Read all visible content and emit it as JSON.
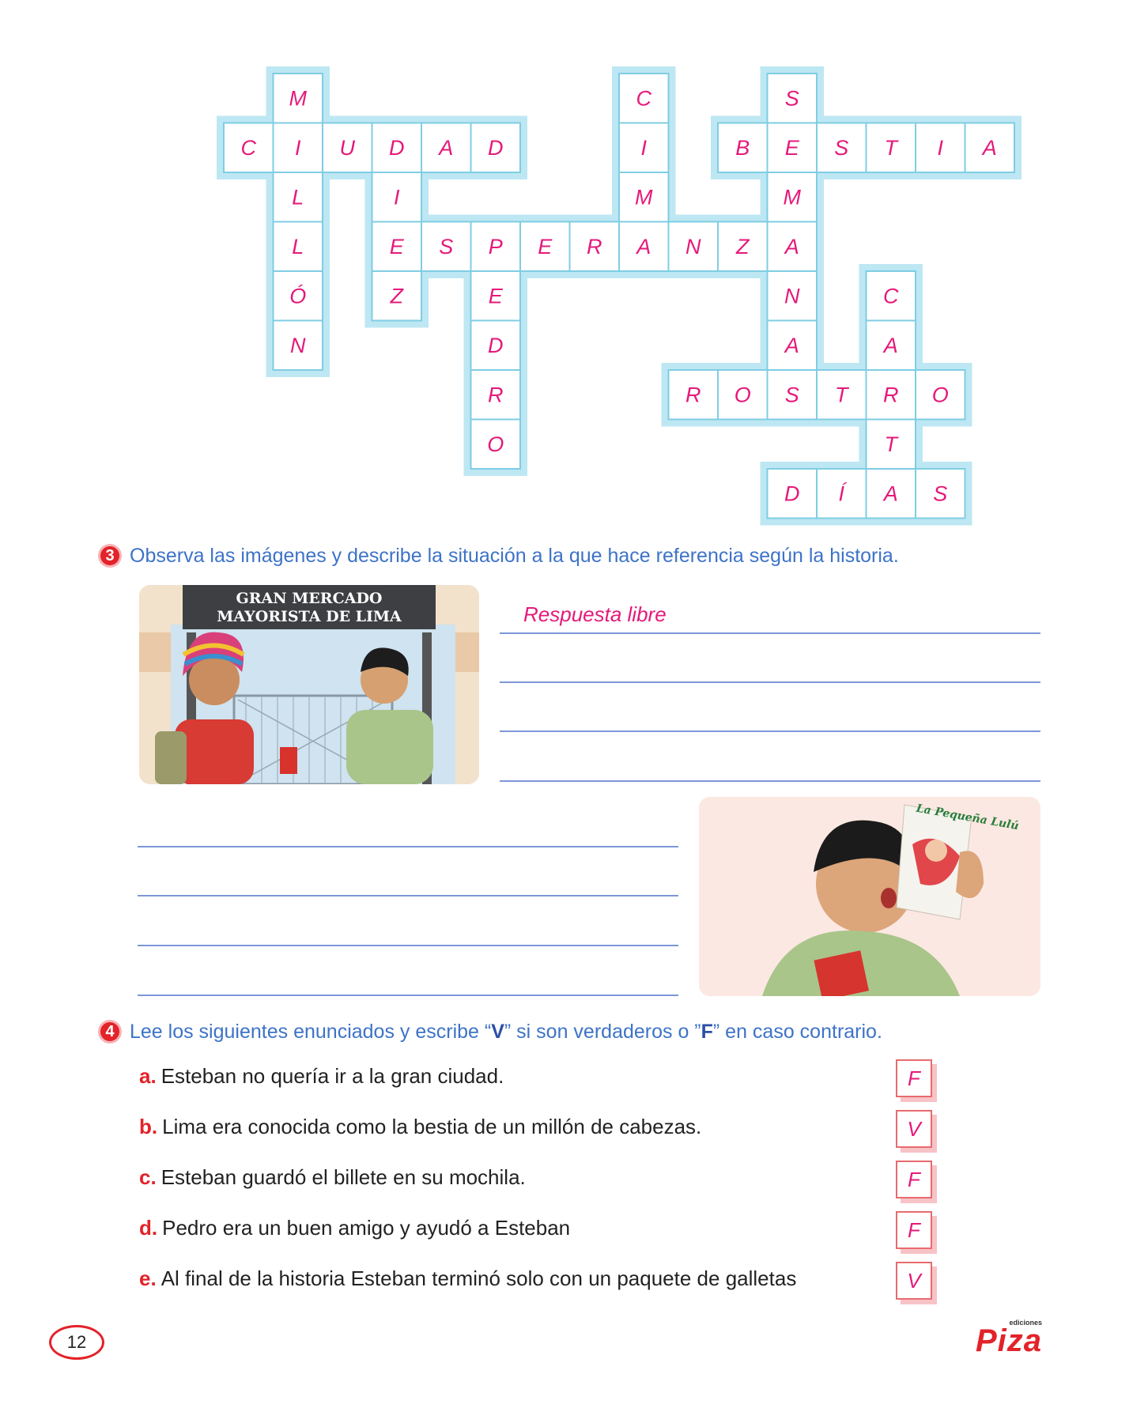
{
  "crossword": {
    "words": [
      {
        "id": "millon",
        "row": 0,
        "col": 1,
        "dir": "down",
        "letters": [
          "M",
          "I",
          "L",
          "L",
          "Ó",
          "N"
        ]
      },
      {
        "id": "ciudad",
        "row": 1,
        "col": 0,
        "dir": "across",
        "letters": [
          "C",
          "I",
          "U",
          "D",
          "A",
          "D"
        ]
      },
      {
        "id": "diez",
        "row": 1,
        "col": 3,
        "dir": "down",
        "letters": [
          "D",
          "I",
          "E",
          "Z"
        ]
      },
      {
        "id": "cima",
        "row": 0,
        "col": 8,
        "dir": "down",
        "letters": [
          "C",
          "I",
          "M",
          "A"
        ]
      },
      {
        "id": "semana",
        "row": 0,
        "col": 11,
        "dir": "down",
        "letters": [
          "S",
          "E",
          "M",
          "A",
          "N",
          "A"
        ]
      },
      {
        "id": "bestia",
        "row": 1,
        "col": 10,
        "dir": "across",
        "letters": [
          "B",
          "E",
          "S",
          "T",
          "I",
          "A"
        ]
      },
      {
        "id": "esperanza",
        "row": 3,
        "col": 3,
        "dir": "across",
        "letters": [
          "E",
          "S",
          "P",
          "E",
          "R",
          "A",
          "N",
          "Z",
          "A"
        ]
      },
      {
        "id": "pedro",
        "row": 3,
        "col": 5,
        "dir": "down",
        "letters": [
          "P",
          "E",
          "D",
          "R",
          "O"
        ]
      },
      {
        "id": "cartas",
        "row": 4,
        "col": 13,
        "dir": "down",
        "letters": [
          "C",
          "A",
          "R",
          "T",
          "A"
        ]
      },
      {
        "id": "rostro",
        "row": 6,
        "col": 9,
        "dir": "across",
        "letters": [
          "R",
          "O",
          "S",
          "T",
          "R",
          "O"
        ]
      },
      {
        "id": "dias",
        "row": 8,
        "col": 11,
        "dir": "across",
        "letters": [
          "D",
          "Í",
          "A",
          "S"
        ]
      }
    ]
  },
  "q3": {
    "number": "3",
    "instruction": "Observa las imágenes y describe la situación a la que hace referencia según la historia.",
    "sign_line1": "GRAN MERCADO",
    "sign_line2": "MAYORISTA DE LIMA",
    "answer": "Respuesta libre",
    "comic_title": "La Pequeña Lulú"
  },
  "q4": {
    "number": "4",
    "instruction_a": "Lee los siguientes enunciados y escribe “",
    "v": "V",
    "instruction_b": "” si son verdaderos o ”",
    "f": "F",
    "instruction_c": "” en caso contrario.",
    "items": [
      {
        "letter": "a.",
        "text": "Esteban no quería ir a la gran ciudad.",
        "answer": "F"
      },
      {
        "letter": "b.",
        "text": "Lima era conocida como la bestia de un millón de cabezas.",
        "answer": "V"
      },
      {
        "letter": "c.",
        "text": "Esteban guardó el billete en su mochila.",
        "answer": "F"
      },
      {
        "letter": "d.",
        "text": "Pedro era un buen amigo y ayudó a Esteban",
        "answer": "F"
      },
      {
        "letter": "e.",
        "text": "Al final de la historia Esteban terminó solo con un paquete de galletas",
        "answer": "V"
      }
    ]
  },
  "footer": {
    "page_number": "12",
    "logo_text": "Piza",
    "logo_small": "ediciones"
  },
  "colors": {
    "crossword_fill": "#bde7f3",
    "answer_pink": "#e5197a",
    "instruction_blue": "#3d73c7",
    "accent_red": "#e32229"
  }
}
